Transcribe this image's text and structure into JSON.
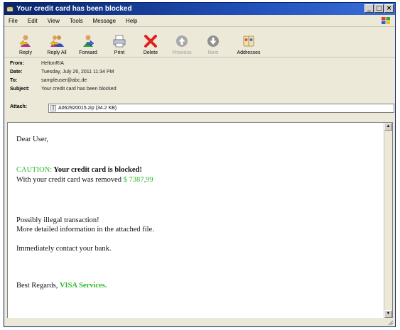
{
  "window": {
    "title": "Your credit card has been blocked"
  },
  "menu": [
    "File",
    "Edit",
    "View",
    "Tools",
    "Message",
    "Help"
  ],
  "toolbar": [
    {
      "label": "Reply",
      "icon": "reply-icon",
      "enabled": true
    },
    {
      "label": "Reply All",
      "icon": "reply-all-icon",
      "enabled": true
    },
    {
      "label": "Forward",
      "icon": "forward-icon",
      "enabled": true
    },
    {
      "label": "Print",
      "icon": "print-icon",
      "enabled": true
    },
    {
      "label": "Delete",
      "icon": "delete-icon",
      "enabled": true
    },
    {
      "label": "Previous",
      "icon": "previous-icon",
      "enabled": false
    },
    {
      "label": "Next",
      "icon": "next-icon",
      "enabled": false
    },
    {
      "label": "Addresses",
      "icon": "addresses-icon",
      "enabled": true
    }
  ],
  "headers": {
    "from_label": "From:",
    "from": "HeltonRIA",
    "date_label": "Date:",
    "date": "Tuesday, July 26, 2011 11:34 PM",
    "to_label": "To:",
    "to": "sampleuser@abc.de",
    "subject_label": "Subject:",
    "subject": "Your credit card has been blocked",
    "attach_label": "Attach:",
    "attachment": "A062920015.zip (34.2 KB)"
  },
  "body": {
    "greeting": "Dear User,",
    "caution_label": "CAUTION:",
    "caution_text": " Your credit card is blocked!",
    "removed_text": "With your credit card was removed",
    "amount": " $ 7387,99",
    "line_illegal": "Possibly illegal transaction!",
    "line_info": "More detailed information in the attached file.",
    "line_contact": "Immediately contact your bank.",
    "regards": "Best Regards, ",
    "signature": "VISA Services."
  },
  "colors": {
    "accent_green": "#2eb82e",
    "titlebar": "#0a246a"
  }
}
